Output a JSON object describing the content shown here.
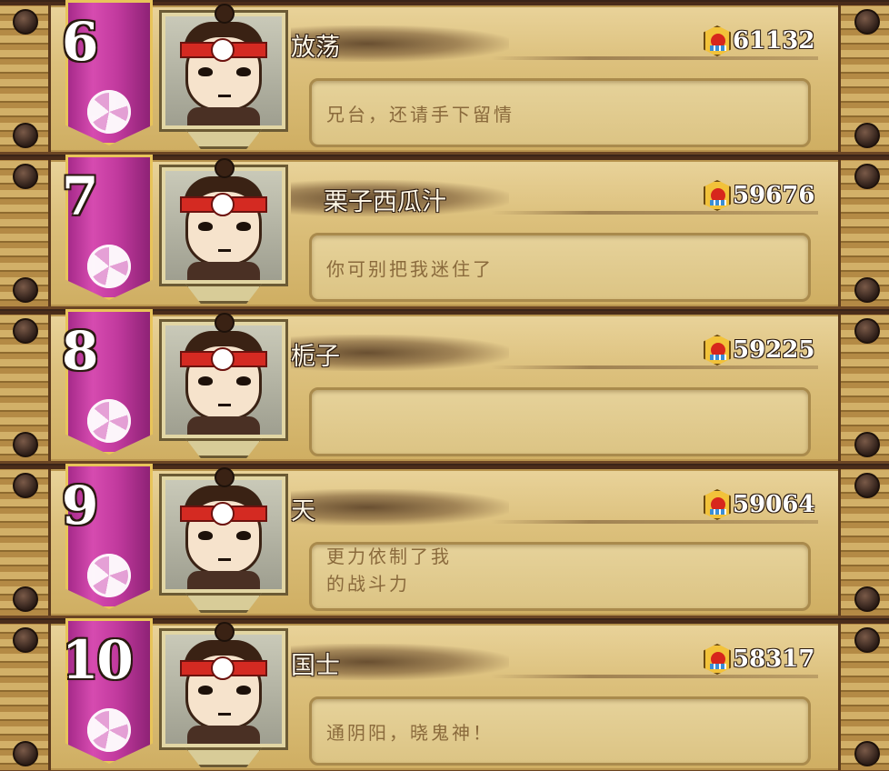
{
  "leaderboard": [
    {
      "rank": "6",
      "name": "放荡",
      "power": "61132",
      "message": "兄台，还请手下留情"
    },
    {
      "rank": "7",
      "name": "栗子西瓜汁",
      "power": "59676",
      "message": "你可别把我迷住了"
    },
    {
      "rank": "8",
      "name": "栀子",
      "power": "59225",
      "message": ""
    },
    {
      "rank": "9",
      "name": "天",
      "power": "59064",
      "message": "更力依制了我\n的战斗力"
    },
    {
      "rank": "10",
      "name": "国士",
      "power": "58317",
      "message": "通阴阳，晓鬼神！"
    }
  ],
  "colors": {
    "banner": "#c23a9e",
    "panel": "#dcc07c",
    "frame_dark": "#4a2c1a",
    "power_icon": "#f2c23a"
  },
  "icons": {
    "power": "battle-power-badge-icon",
    "banner_emblem": "tomoe-swirl-icon"
  }
}
